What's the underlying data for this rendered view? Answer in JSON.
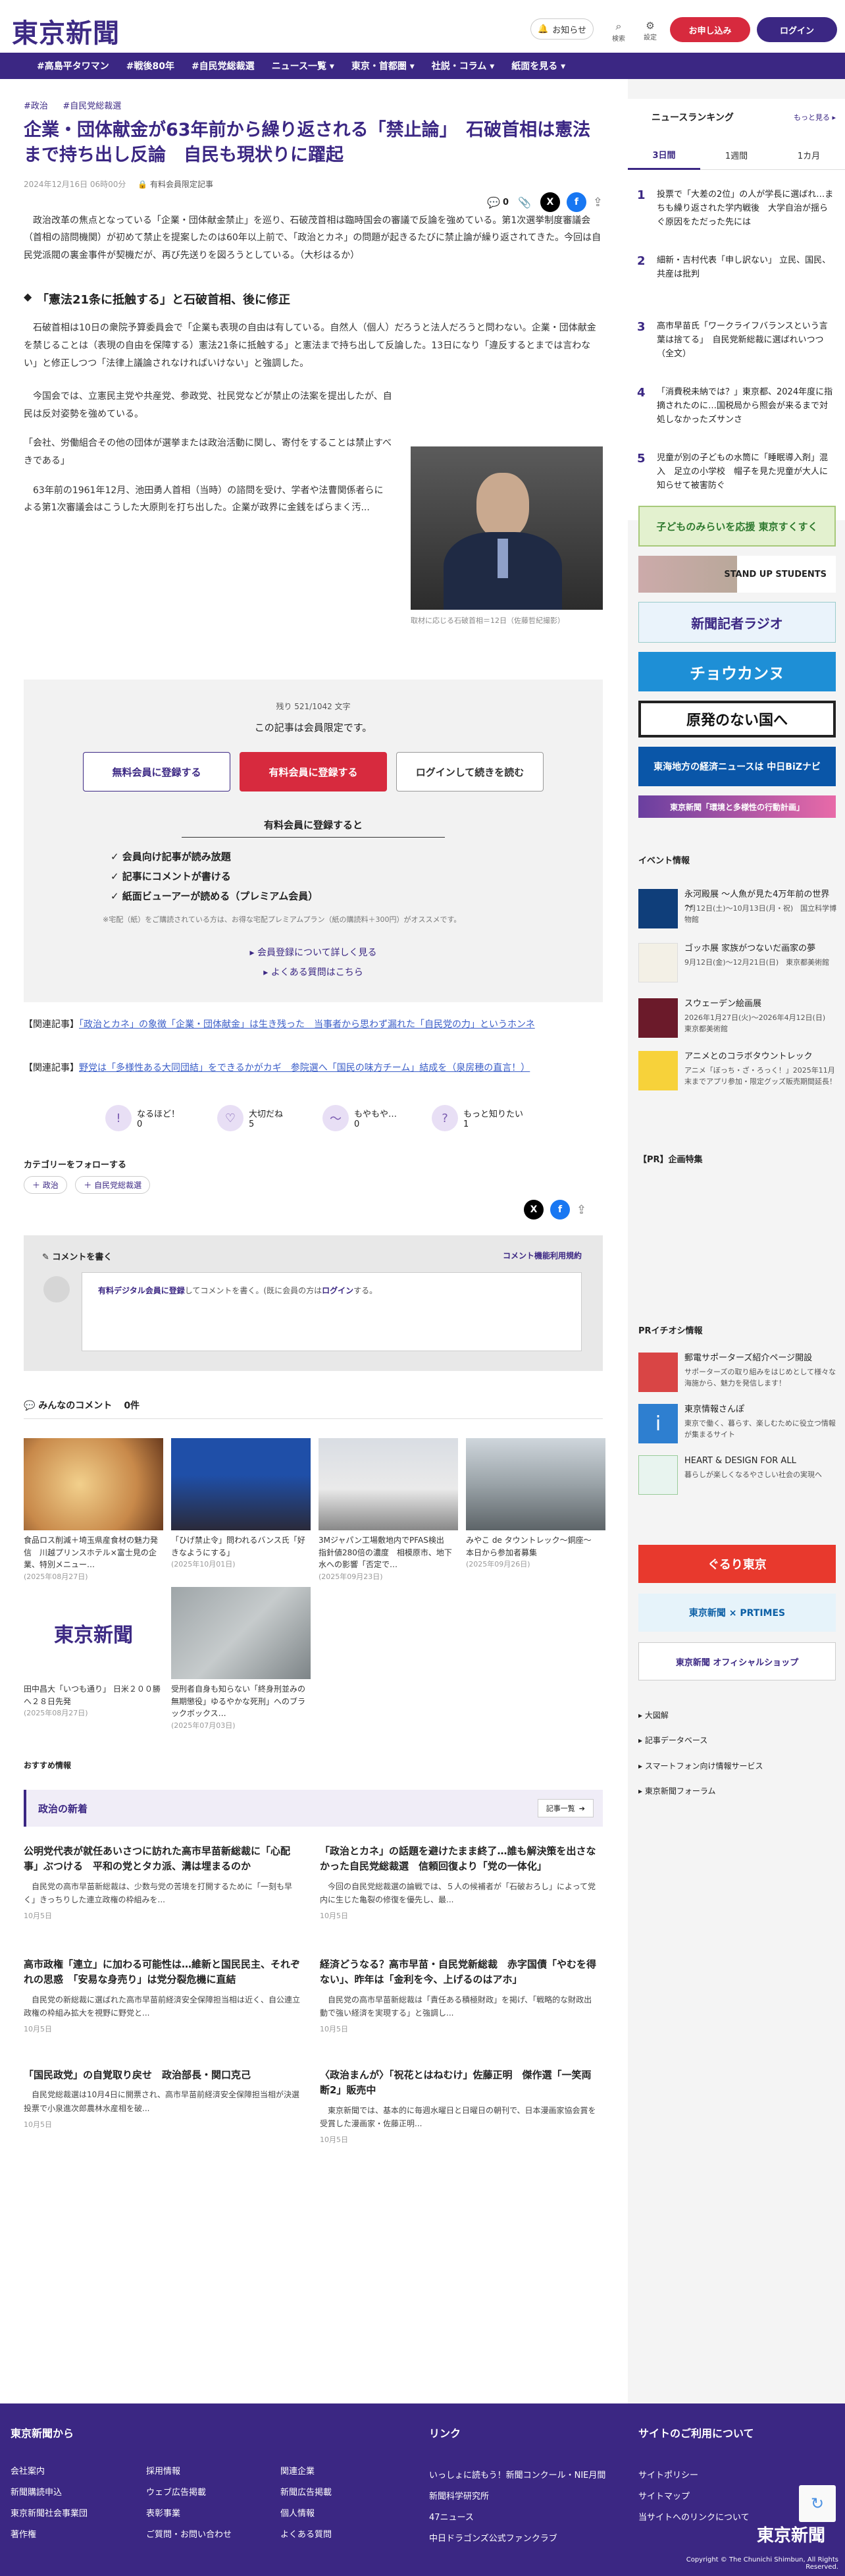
{
  "header": {
    "logo": "東京新聞",
    "notice": "お知らせ",
    "search": "検索",
    "settings": "設定",
    "signup": "お申し込み",
    "login": "ログイン"
  },
  "nav": {
    "items": [
      "#高島平タワマン",
      "#戦後80年",
      "#自民党総裁選",
      "ニュース一覧 ▾",
      "東京・首都圏 ▾",
      "社説・コラム ▾",
      "紙面を見る ▾"
    ]
  },
  "article": {
    "tags": [
      "#政治",
      "#自民党総裁選"
    ],
    "title": "企業・団体献金が63年前から繰り返される「禁止論」　石破首相は憲法まで持ち出し反論　自民も現状りに躍起",
    "date": "2024年12月16日 06時00分",
    "member_badge": "有料会員限定記事",
    "comment_count": "0",
    "p1": "　政治改革の焦点となっている「企業・団体献金禁止」を巡り、石破茂首相は臨時国会の審議で反論を強めている。第1次選挙制度審議会（首相の諮問機関）が初めて禁止を提案したのは60年以上前で、「政治とカネ」の問題が起きるたびに禁止論が繰り返されてきた。今回は自民党派閥の裏金事件が契機だが、再び先送りを図ろうとしている。（大杉はるか）",
    "h2": "「憲法21条に抵触する」と石破首相、後に修正",
    "p2": "　石破首相は10日の衆院予算委員会で「企業も表現の自由は有している。自然人（個人）だろうと法人だろうと問わない。企業・団体献金を禁じることは（表現の自由を保障する）憲法21条に抵触する」と憲法まで持ち出して反論した。13日になり「違反するとまでは言わない」と修正しつつ「法律上議論されなければいけない」と強調した。",
    "p3": "　今国会では、立憲民主党や共産党、参政党、社民党などが禁止の法案を提出したが、自民は反対姿勢を強めている。",
    "p4": "「会社、労働組合その他の団体が選挙または政治活動に関し、寄付をすることは禁止すべきである」",
    "p5": "　63年前の1961年12月、池田勇人首相（当時）の諮問を受け、学者や法曹関係者らによる第1次審議会はこうした大原則を打ち出した。企業が政界に金銭をばらまく汚...",
    "photo_caption": "取材に応じる石破首相＝12日（佐藤哲紀撮影）"
  },
  "paywall": {
    "remaining": "残り 521/1042 文字",
    "msg": "この記事は会員限定です。",
    "free_btn": "無料会員に登録する",
    "paid_btn": "有料会員に登録する",
    "login_btn": "ログインして続きを読む",
    "benefit_title": "有料会員に登録すると",
    "benefits": [
      "✓ 会員向け記事が読み放題",
      "✓ 記事にコメントが書ける",
      "✓ 紙面ビューアーが読める（プレミアム会員）"
    ],
    "note": "※宅配（紙）をご購読されている方は、お得な宅配プレミアムプラン（紙の購読料＋300円）がオススメです。",
    "link1": "▸ 会員登録について詳しく見る",
    "link2": "▸ よくある質問はこちら"
  },
  "related": [
    {
      "prefix": "【関連記事】",
      "text": "「政治とカネ」の象徴「企業・団体献金」は生き残った　当事者から思わず漏れた「自民党の力」というホンネ"
    },
    {
      "prefix": "【関連記事】",
      "text": "野党は「多様性ある大同団結」をできるかがカギ　参院選へ「国民の味方チーム」結成を（泉房穂の直言！）"
    }
  ],
  "reactions": [
    {
      "label": "なるほど！",
      "count": "0"
    },
    {
      "label": "大切だね",
      "count": "5"
    },
    {
      "label": "もやもや…",
      "count": "0"
    },
    {
      "label": "もっと知りたい",
      "count": "1"
    }
  ],
  "follow": {
    "title": "カテゴリーをフォローする",
    "chips": [
      "＋ 政治",
      "＋ 自民党総裁選"
    ]
  },
  "comment": {
    "write": "コメントを書く",
    "rules": "コメント機能利用規約",
    "prompt_pre": "有料デジタル会員に登録",
    "prompt_mid": "してコメントを書く。(既に会員の方は",
    "prompt_login": "ログイン",
    "prompt_post": "する。"
  },
  "everyone": {
    "title": "みんなのコメント",
    "count": "0件"
  },
  "thumbs": [
    {
      "cap": "食品ロス削減＋埼玉県産食材の魅力発信　川越プリンスホテル×富士見の企業、特別メニュー…",
      "date": "(2025年08月27日)"
    },
    {
      "cap": "「ひげ禁止令」問われるバンス氏「好きなようにする」",
      "date": "(2025年10月01日)"
    },
    {
      "cap": "3Mジャパン工場敷地内でPFAS検出　指針値280倍の濃度　相模原市、地下水への影響「否定で…",
      "date": "(2025年09月23日)"
    },
    {
      "cap": "みやこ de タウントレック～銅座～　本日から参加者募集",
      "date": "(2025年09月26日)"
    },
    {
      "cap": "田中昌大「いつも通り」 日米２００勝へ２８日先発",
      "date": "(2025年08月27日)"
    },
    {
      "cap": "受刑者自身も知らない「終身刑並みの無期懲役」ゆるやかな死刑」へのブラックボックス…",
      "date": "(2025年07月03日)"
    }
  ],
  "recommended": "おすすめ情報",
  "politics": {
    "title": "政治の新着",
    "more": "記事一覧",
    "items": [
      {
        "t": "公明党代表が就任あいさつに訪れた高市早苗新総裁に「心配事」ぶつける　平和の党とタカ派、溝は埋まるのか",
        "d": "　自民党の高市早苗新総裁は、少数与党の苦境を打開するために「一刻も早く」きっちりした連立政権の枠組みを...",
        "dt": "10月5日"
      },
      {
        "t": "「政治とカネ」の話題を避けたまま終了…誰も解決策を出さなかった自民党総裁選　信頼回復より「党の一体化」",
        "d": "　今回の自民党総裁選の論戦では、５人の候補者が「石破おろし」によって党内に生じた亀裂の修復を優先し、最...",
        "dt": "10月5日"
      },
      {
        "t": "高市政権「連立」に加わる可能性は…維新と国民民主、それぞれの思惑　「安易な身売り」は党分裂危機に直結",
        "d": "　自民党の新総裁に選ばれた高市早苗前経済安全保障担当相は近く、自公連立政権の枠組み拡大を視野に野党と...",
        "dt": "10月5日"
      },
      {
        "t": "経済どうなる？高市早苗・自民党新総裁　赤字国債「やむを得ない」、昨年は「金利を今、上げるのはアホ」",
        "d": "　自民党の高市早苗新総裁は「責任ある積極財政」を掲げ、「戦略的な財政出動で強い経済を実現する」と強調し...",
        "dt": "10月5日"
      },
      {
        "t": "「国民政党」の自覚取り戻せ　政治部長・関口克己",
        "d": "　自民党総裁選は10月4日に開票され、高市早苗前経済安全保障担当相が決選投票で小泉進次郎農林水産相を破...",
        "dt": "10月5日"
      },
      {
        "t": "〈政治まんが〉「祝花とはねむけ」佐藤正明　傑作選「一笑両断2」販売中",
        "d": "　東京新聞では、基本的に毎週水曜日と日曜日の朝刊で、日本漫画家協会賞を受賞した漫画家・佐藤正明...",
        "dt": "10月5日"
      }
    ]
  },
  "side": {
    "rank_title": "ニュースランキング",
    "rank_more": "もっと見る ▸",
    "rank_tabs": [
      "3日間",
      "1週間",
      "1カ月"
    ],
    "ranks": [
      {
        "n": "1",
        "t": "投票で「大差の2位」の人が学長に選ばれ…まちも繰り返された学内戦後　大学自治が揺らぐ原因をただった先には"
      },
      {
        "n": "2",
        "t": "細新・吉村代表「申し訳ない」 立民、国民、共産は批判"
      },
      {
        "n": "3",
        "t": "高市早苗氏「ワークライフバランスという言葉は捨てる」　自民党新総裁に選ばれいつつ（全文）"
      },
      {
        "n": "4",
        "t": "「消費税未納では？」東京都、2024年度に指摘されたのに…国税局から照会が来るまで対処しなかったズサンさ"
      },
      {
        "n": "5",
        "t": "児童が別の子どもの水筒に「睡眠導入剤」混入　足立の小学校　帽子を見た児童が大人に知らせて被害防ぐ"
      }
    ],
    "banners": [
      "子どものみらいを応援 東京すくすく",
      "STAND UP STUDENTS",
      "新聞記者ラジオ",
      "チョウカンヌ",
      "原発のない国へ",
      "東海地方の経済ニュースは 中日BiZナビ",
      "東京新聞「環境と多様性の行動計画」"
    ],
    "event_title": "イベント情報",
    "events": [
      {
        "t": "永河殿展 ～人魚が見た4万年前の世界～",
        "d": "7月12日(土)～10月13日(月・祝)　国立科学博物館"
      },
      {
        "t": "ゴッホ展 家族がつないだ画家の夢",
        "d": "9月12日(金)～12月21日(日)　東京都美術館"
      },
      {
        "t": "スウェーデン絵画展",
        "d": "2026年1月27日(火)～2026年4月12日(日)　東京都美術館"
      },
      {
        "t": "アニメとのコラボタウントレック",
        "d": "アニメ「ぼっち・ざ・ろっく！」2025年11月末までアプリ参加・限定グッズ販売期間延長！"
      }
    ],
    "pr_title": "【PR】企画特集",
    "prinfo_title": "PRイチオシ情報",
    "prinfo": [
      {
        "t": "郵電サポーターズ紹介ページ開設",
        "d": "サポーターズの取り組みをはじめとして様々な海施から、魅力を発信します！"
      },
      {
        "t": "東京情報さんぽ",
        "d": "東京で働く、暮らす、楽しむために役立つ情報が集まるサイト"
      },
      {
        "t": "HEART & DESIGN FOR ALL",
        "d": "暮らしが楽しくなるやさしい社会の実現へ"
      }
    ],
    "links": [
      "大図解",
      "記事データベース",
      "スマートフォン向け情報サービス",
      "東京新聞フォーラム"
    ]
  },
  "footer": {
    "col1_title": "東京新聞から",
    "col2_title": "リンク",
    "col3_title": "サイトのご利用について",
    "col1a": [
      "会社案内",
      "新聞購読申込",
      "東京新聞社会事業団",
      "著作権"
    ],
    "col1b": [
      "採用情報",
      "ウェブ広告掲載",
      "表彰事業",
      "ご質問・お問い合わせ"
    ],
    "col1c": [
      "関連企業",
      "新聞広告掲載",
      "個人情報",
      "よくある質問"
    ],
    "col2": [
      "いっしょに読もう！新聞コンクール・NIE月間",
      "新聞科学研究所",
      "47ニュース",
      "中日ドラゴンズ公式ファンクラブ"
    ],
    "col3": [
      "サイトポリシー",
      "サイトマップ",
      "当サイトへのリンクについて"
    ],
    "logo": "東京新聞",
    "copyright": "Copyright © The Chunichi Shimbun, All Rights Reserved."
  }
}
